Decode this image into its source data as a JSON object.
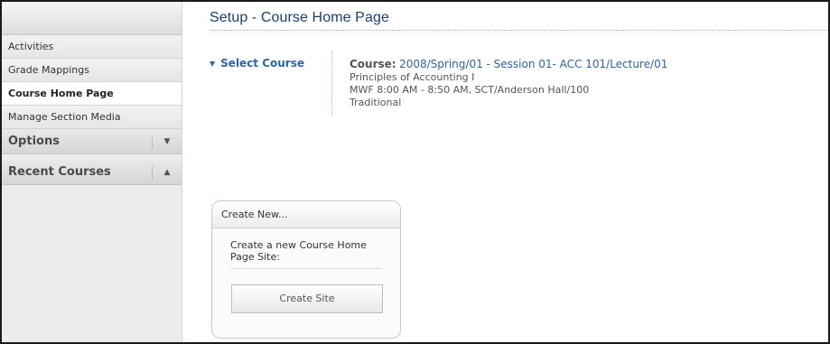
{
  "sidebar": {
    "items": [
      {
        "label": "Activities"
      },
      {
        "label": "Grade Mappings"
      },
      {
        "label": "Course Home Page",
        "active": true
      },
      {
        "label": "Manage Section Media"
      }
    ],
    "sections": [
      {
        "label": "Options",
        "arrow": "▼",
        "arrow_icon": "triangle-down-icon"
      },
      {
        "label": "Recent Courses",
        "arrow": "▲",
        "arrow_icon": "triangle-up-icon"
      }
    ]
  },
  "main": {
    "page_title": "Setup - Course Home Page",
    "select_course": {
      "label": "Select Course",
      "icon": "▼"
    },
    "course": {
      "label": "Course:",
      "link": "2008/Spring/01 - Session 01- ACC 101/Lecture/01",
      "name": "Principles of Accounting I",
      "schedule": "MWF 8:00 AM - 8:50 AM, SCT/Anderson Hall/100",
      "type": "Traditional"
    },
    "create_panel": {
      "title": "Create New...",
      "description": "Create a new Course Home Page Site:",
      "button_label": "Create Site"
    }
  },
  "colors": {
    "title": "#1c3f6e",
    "link": "#2d64a8",
    "sidebar_bg": "#ececec",
    "frame_border": "#1a1a1a"
  }
}
